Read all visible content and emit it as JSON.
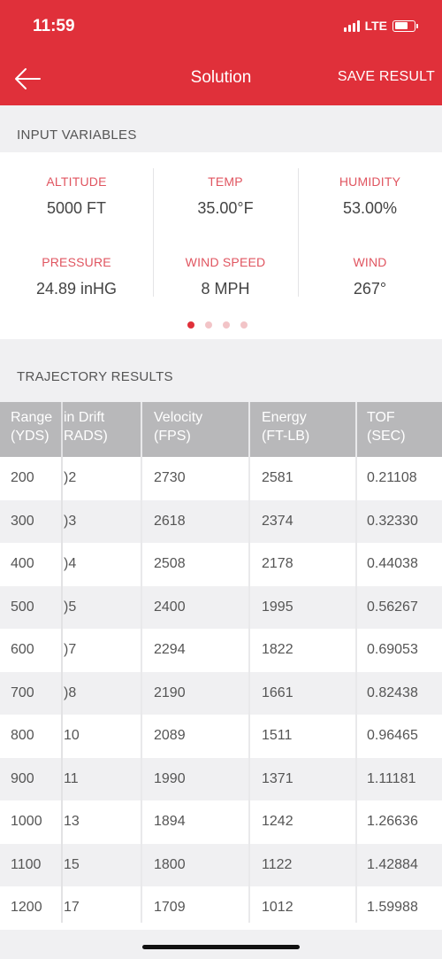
{
  "status": {
    "time": "11:59",
    "network": "LTE"
  },
  "nav": {
    "back_icon": "arrow-left-icon",
    "title": "Solution",
    "save_label": "SAVE RESULT"
  },
  "input_variables": {
    "heading": "INPUT VARIABLES",
    "items": [
      {
        "label": "ALTITUDE",
        "value": "5000 FT"
      },
      {
        "label": "TEMP",
        "value": "35.00°F"
      },
      {
        "label": "HUMIDITY",
        "value": "53.00%"
      },
      {
        "label": "PRESSURE",
        "value": "24.89 inHG"
      },
      {
        "label": "WIND SPEED",
        "value": "8 MPH"
      },
      {
        "label": "WIND",
        "value": "267°"
      }
    ],
    "pager": {
      "pages": 4,
      "active": 1
    }
  },
  "trajectory": {
    "heading": "TRAJECTORY RESULTS",
    "headers": [
      "Range\n(YDS)",
      "in Drift\nRADS)",
      "Velocity\n(FPS)",
      "Energy\n(FT-LB)",
      "TOF\n(SEC)"
    ],
    "rows": [
      [
        "200",
        ")2",
        "2730",
        "2581",
        "0.21108"
      ],
      [
        "300",
        ")3",
        "2618",
        "2374",
        "0.32330"
      ],
      [
        "400",
        ")4",
        "2508",
        "2178",
        "0.44038"
      ],
      [
        "500",
        ")5",
        "2400",
        "1995",
        "0.56267"
      ],
      [
        "600",
        ")7",
        "2294",
        "1822",
        "0.69053"
      ],
      [
        "700",
        ")8",
        "2190",
        "1661",
        "0.82438"
      ],
      [
        "800",
        "10",
        "2089",
        "1511",
        "0.96465"
      ],
      [
        "900",
        "11",
        "1990",
        "1371",
        "1.11181"
      ],
      [
        "1000",
        "13",
        "1894",
        "1242",
        "1.26636"
      ],
      [
        "1100",
        "15",
        "1800",
        "1122",
        "1.42884"
      ],
      [
        "1200",
        "17",
        "1709",
        "1012",
        "1.59988"
      ]
    ]
  },
  "colors": {
    "accent": "#e0303a",
    "label": "#e05560",
    "header_bg": "#b8b8ba"
  }
}
